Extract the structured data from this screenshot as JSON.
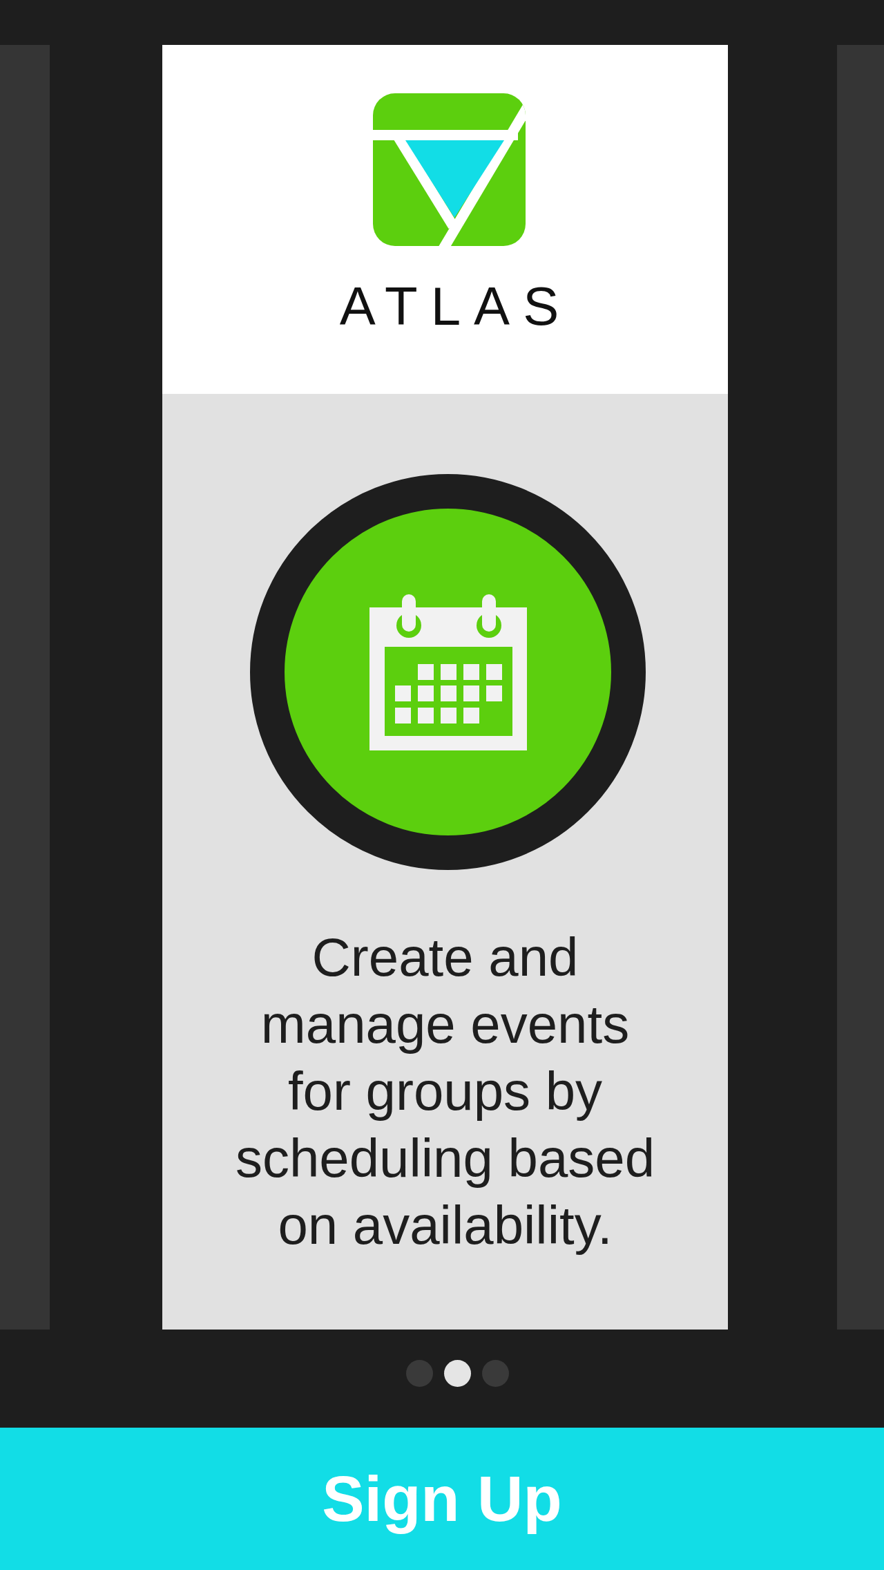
{
  "app": {
    "name": "ATLAS"
  },
  "feature": {
    "description": "Create and manage events for groups by scheduling based on availability."
  },
  "pager": [
    {
      "selected": false
    },
    {
      "selected": true
    },
    {
      "selected": false
    }
  ],
  "sign_up_button": {
    "label": "Sign Up"
  }
}
